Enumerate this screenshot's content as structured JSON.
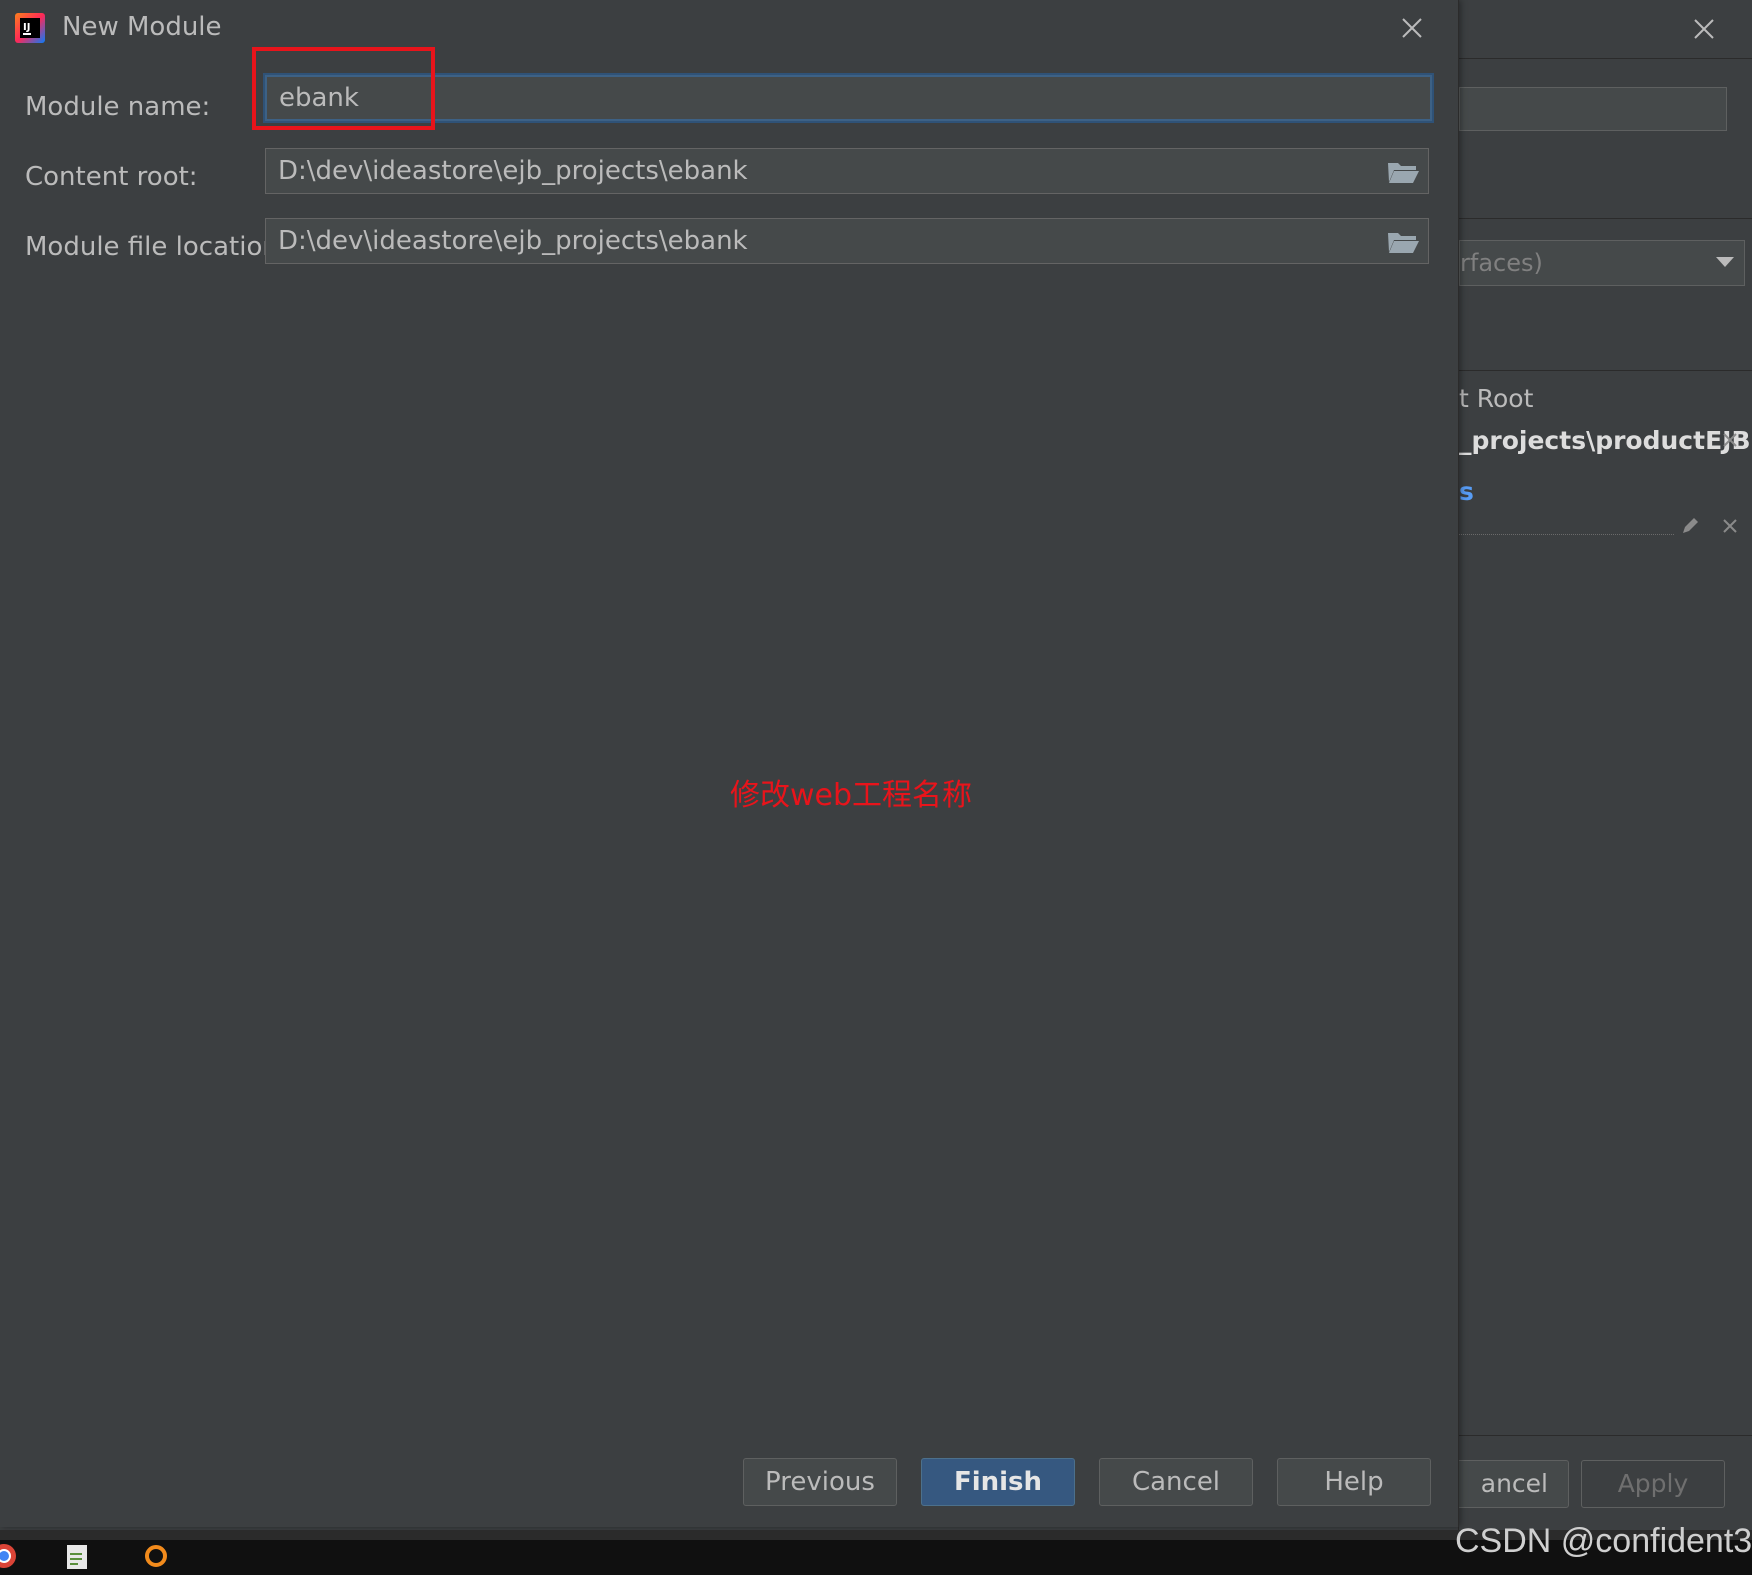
{
  "dialog": {
    "title": "New Module",
    "module_name_label": "Module name:",
    "module_name_value": "ebank",
    "content_root_label": "Content root:",
    "content_root_value": "D:\\dev\\ideastore\\ejb_projects\\ebank",
    "module_file_location_label": "Module file location:",
    "module_file_location_value": "D:\\dev\\ideastore\\ejb_projects\\ebank",
    "annotation": "修改web工程名称",
    "buttons": {
      "previous": "Previous",
      "finish": "Finish",
      "cancel": "Cancel",
      "help": "Help"
    }
  },
  "background_dialog": {
    "select_value_partial": "rfaces)",
    "root_label_partial": "t Root",
    "path_partial": "_projects\\productEJB",
    "link_partial": "s",
    "cancel_partial": "ancel",
    "apply": "Apply"
  },
  "watermark": "CSDN @confident3",
  "colors": {
    "background": "#3c3f41",
    "field_bg": "#45494a",
    "primary_button": "#365880",
    "annotation_red": "#e8141b",
    "focus_border": "#3d6185"
  },
  "icons": {
    "app": "intellij-idea-icon",
    "close": "close-icon",
    "folder": "folder-open-icon"
  }
}
